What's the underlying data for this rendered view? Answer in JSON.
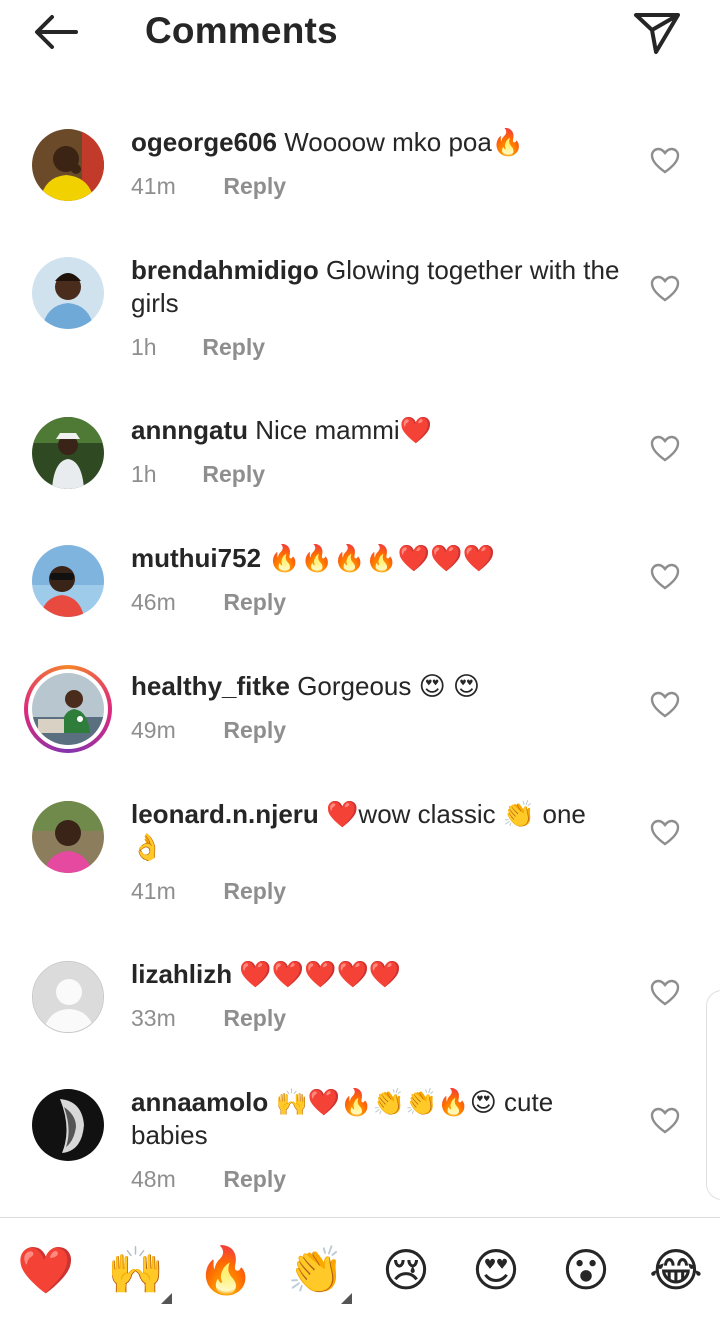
{
  "header": {
    "title": "Comments",
    "back_icon": "arrow-left-icon",
    "send_icon": "paper-plane-icon"
  },
  "comments": [
    {
      "username": "ogeorge606",
      "text": "Woooow mko poa🔥",
      "time": "41m",
      "reply": "Reply",
      "avatar": "photo-man-yellow-shirt"
    },
    {
      "username": "brendahmidigo",
      "text": "Glowing together with the girls",
      "time": "1h",
      "reply": "Reply",
      "avatar": "photo-woman-blue-shirt"
    },
    {
      "username": "annngatu",
      "text": "Nice mammi❤️",
      "time": "1h",
      "reply": "Reply",
      "avatar": "photo-person-garden"
    },
    {
      "username": "muthui752",
      "text": "🔥🔥🔥🔥❤️❤️❤️",
      "time": "46m",
      "reply": "Reply",
      "avatar": "photo-man-sunglasses"
    },
    {
      "username": "healthy_fitke",
      "text": "Gorgeous 😍 😍",
      "time": "49m",
      "reply": "Reply",
      "avatar": "photo-people-table-story"
    },
    {
      "username": "leonard.n.njeru",
      "text": "❤️wow classic 👏 one 👌",
      "time": "41m",
      "reply": "Reply",
      "avatar": "photo-man-pink-shirt"
    },
    {
      "username": "lizahlizh",
      "text": "❤️❤️❤️❤️❤️",
      "time": "33m",
      "reply": "Reply",
      "avatar": "default-avatar"
    },
    {
      "username": "annaamolo",
      "text": "🙌❤️🔥👏👏🔥😍 cute babies",
      "time": "48m",
      "reply": "Reply",
      "avatar": "photo-dark-portrait"
    }
  ],
  "quick_reactions": [
    "❤️",
    "🙌",
    "🔥",
    "👏",
    "😢",
    "😍",
    "😮",
    "😂"
  ],
  "colors": {
    "text": "#262626",
    "secondary": "#8e8e8e",
    "heart": "#ed4956"
  }
}
